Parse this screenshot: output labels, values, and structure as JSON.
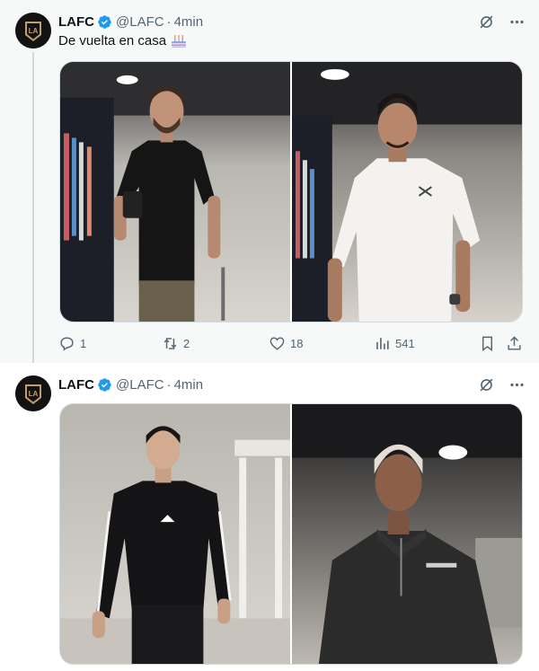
{
  "tweets": [
    {
      "author": {
        "name": "LAFC",
        "handle": "@LAFC",
        "verified": true
      },
      "separator": "·",
      "time": "4min",
      "text": "De vuelta en casa",
      "emoji": "birthday-cake-icon",
      "media": [
        {
          "name": "photo-player-black-tshirt",
          "desc": "player-in-black-tshirt"
        },
        {
          "name": "photo-player-white-tshirt",
          "desc": "player-in-white-tshirt"
        }
      ],
      "actions": {
        "replies": "1",
        "reposts": "2",
        "likes": "18",
        "views": "541"
      }
    },
    {
      "author": {
        "name": "LAFC",
        "handle": "@LAFC",
        "verified": true
      },
      "separator": "·",
      "time": "4min",
      "media": [
        {
          "name": "photo-player-black-sweatshirt",
          "desc": "player-in-black-sweatshirt"
        },
        {
          "name": "photo-player-grey-halfzip",
          "desc": "player-in-grey-halfzip"
        }
      ]
    }
  ],
  "colors": {
    "accent": "#1d9bf0",
    "muted": "#536471",
    "tweet_bg_hover": "#f7f9f9"
  }
}
